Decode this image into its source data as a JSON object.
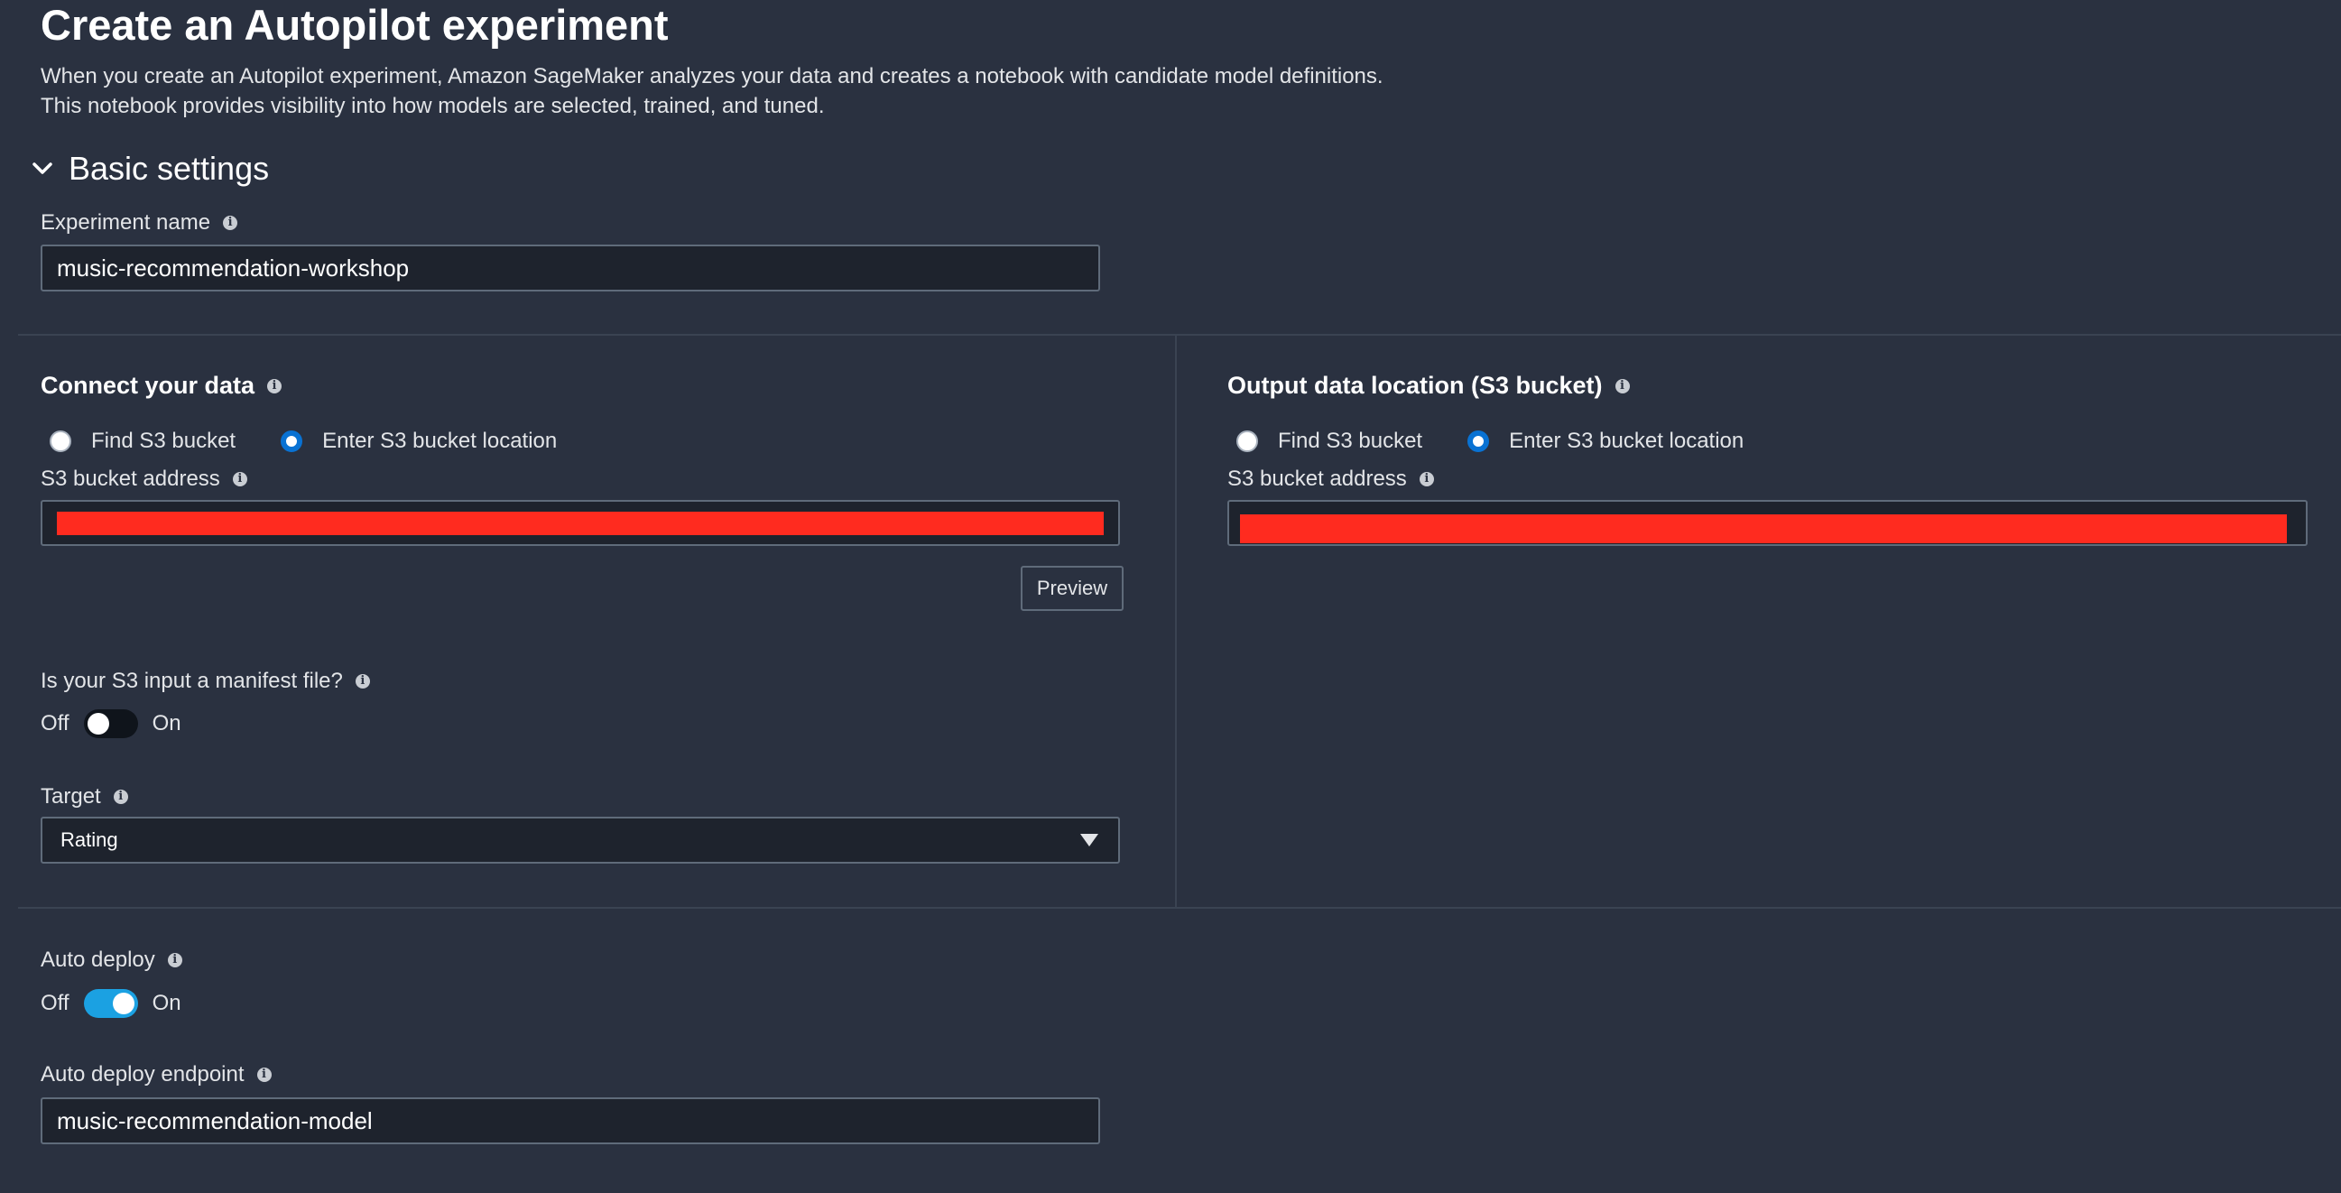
{
  "page": {
    "title": "Create an Autopilot experiment",
    "description_line1": "When you create an Autopilot experiment, Amazon SageMaker analyzes your data and creates a notebook with candidate model definitions.",
    "description_line2": "This notebook provides visibility into how models are selected, trained, and tuned."
  },
  "basic_settings": {
    "section_title": "Basic settings",
    "experiment_name_label": "Experiment name",
    "experiment_name_value": "music-recommendation-workshop"
  },
  "connect_data": {
    "heading": "Connect your data",
    "radio_find": "Find S3 bucket",
    "radio_enter": "Enter S3 bucket location",
    "selected": "Enter S3 bucket location",
    "address_label": "S3 bucket address",
    "preview_button": "Preview",
    "manifest_label": "Is your S3 input a manifest file?",
    "manifest_off": "Off",
    "manifest_on": "On",
    "manifest_state": false,
    "target_label": "Target",
    "target_value": "Rating"
  },
  "output_data": {
    "heading": "Output data location (S3 bucket)",
    "radio_find": "Find S3 bucket",
    "radio_enter": "Enter S3 bucket location",
    "selected": "Enter S3 bucket location",
    "address_label": "S3 bucket address"
  },
  "auto_deploy": {
    "label": "Auto deploy",
    "off": "Off",
    "on": "On",
    "state": true,
    "endpoint_label": "Auto deploy endpoint",
    "endpoint_value": "music-recommendation-model"
  },
  "colors": {
    "background": "#2a3140",
    "accent_radio": "#0972d3",
    "toggle_on": "#1ba1e2",
    "redaction": "#ff2b1f"
  },
  "icons": [
    "chevron-down-icon",
    "info-icon",
    "caret-down-icon"
  ]
}
